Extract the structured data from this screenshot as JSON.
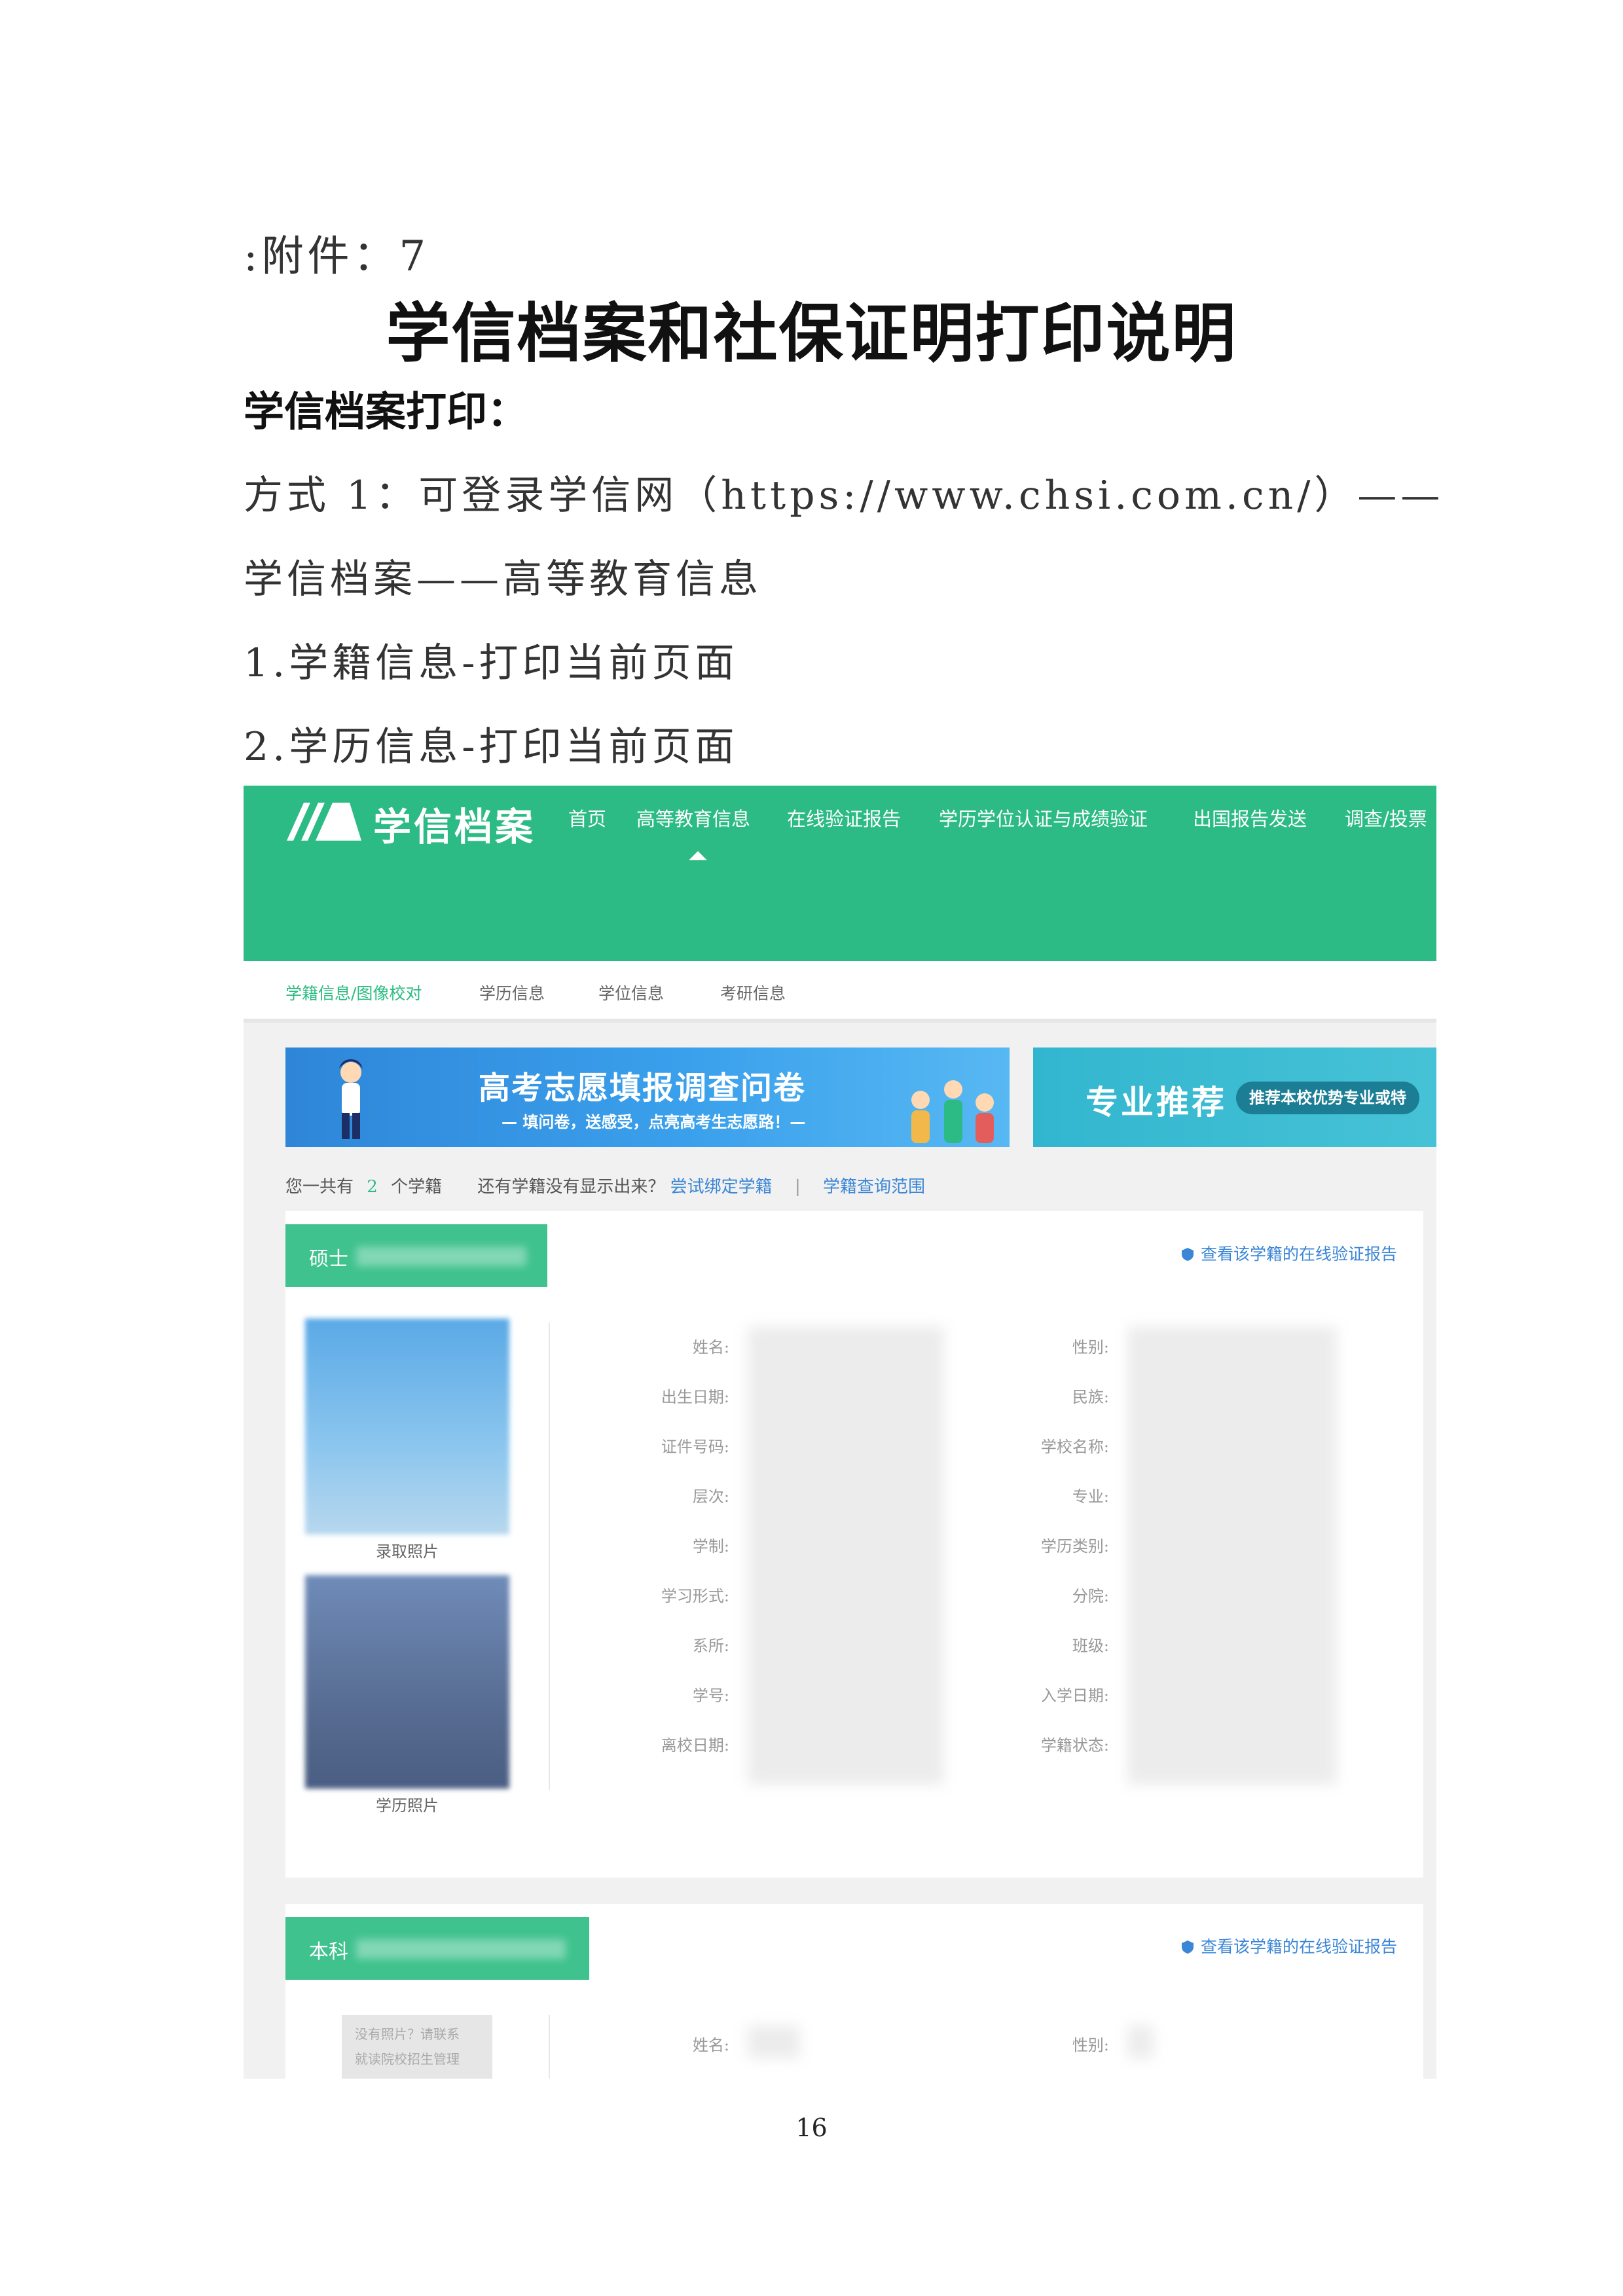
{
  "doc": {
    "attachment": ":附件：7",
    "title": "学信档案和社保证明打印说明",
    "section": "学信档案打印：",
    "line1": "方式 1：可登录学信网（https://www.chsi.com.cn/）——",
    "line2": "学信档案——高等教育信息",
    "line3": "1.学籍信息-打印当前页面",
    "line4": "2.学历信息-打印当前页面",
    "page_number": "16"
  },
  "screenshot": {
    "brand": "学信档案",
    "nav": [
      "首页",
      "高等教育信息",
      "在线验证报告",
      "学历学位认证与成绩验证",
      "出国报告发送",
      "调查/投票"
    ],
    "subtabs": [
      "学籍信息/图像校对",
      "学历信息",
      "学位信息",
      "考研信息"
    ],
    "banner1_title": "高考志愿填报调查问卷",
    "banner1_sub": "— 填问卷，送感受，点亮高考生志愿路！—",
    "banner2_title": "专业推荐",
    "banner2_pill": "推荐本校优势专业或特",
    "count_prefix": "您一共有",
    "count_value": "2",
    "count_suffix": "个学籍",
    "missing_text": "还有学籍没有显示出来？",
    "bind_link": "尝试绑定学籍",
    "separator": "|",
    "scope_link": "学籍查询范围",
    "card1_tag": "硕士",
    "card2_tag": "本科",
    "verify_link": "查看该学籍的在线验证报告",
    "photo1_caption": "录取照片",
    "photo2_caption": "学历照片",
    "left_labels": [
      "姓名:",
      "出生日期:",
      "证件号码:",
      "层次:",
      "学制:",
      "学习形式:",
      "系所:",
      "学号:",
      "离校日期:"
    ],
    "right_labels": [
      "性别:",
      "民族:",
      "学校名称:",
      "专业:",
      "学历类别:",
      "分院:",
      "班级:",
      "入学日期:",
      "学籍状态:"
    ],
    "card2_left_label": "姓名:",
    "card2_right_label": "性别:",
    "no_photo_text_1": "没有照片？请联系",
    "no_photo_text_2": "就读院校招生管理"
  },
  "colors": {
    "brand_green": "#2cbb84",
    "link_blue": "#3b86d6"
  }
}
